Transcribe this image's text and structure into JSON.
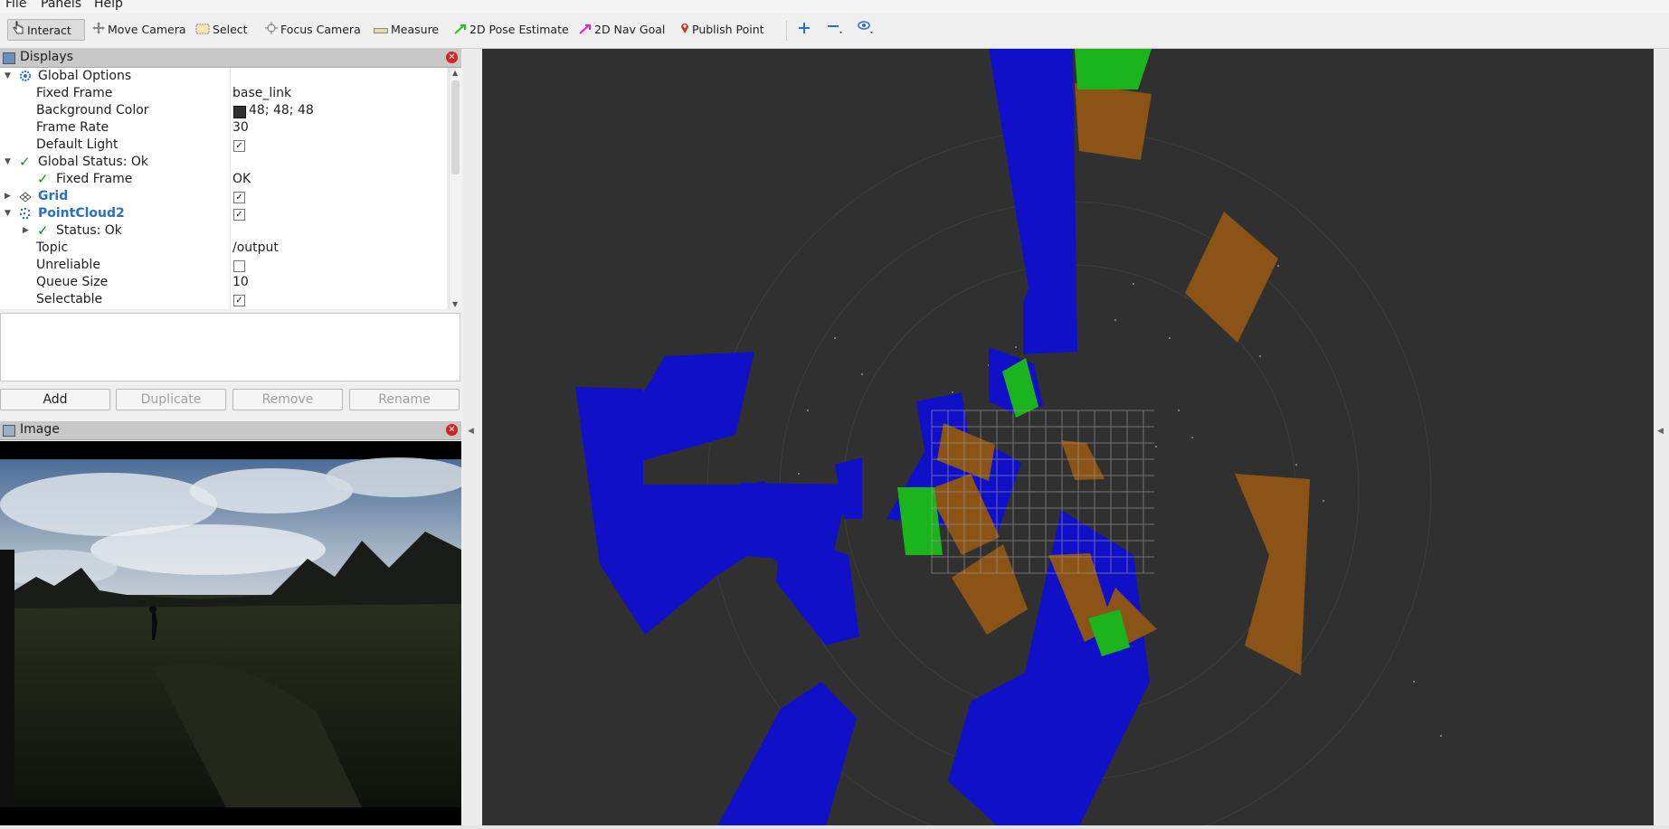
{
  "menu": {
    "file": "File",
    "panels": "Panels",
    "help": "Help"
  },
  "toolbar": {
    "interact": "Interact",
    "move_camera": "Move Camera",
    "select": "Select",
    "focus_camera": "Focus Camera",
    "measure": "Measure",
    "pose_estimate": "2D Pose Estimate",
    "nav_goal": "2D Nav Goal",
    "publish_point": "Publish Point"
  },
  "displays_panel": {
    "title": "Displays",
    "rows": [
      {
        "label": "Global Options",
        "value": ""
      },
      {
        "label": "Fixed Frame",
        "value": "base_link"
      },
      {
        "label": "Background Color",
        "value": "48; 48; 48"
      },
      {
        "label": "Frame Rate",
        "value": "30"
      },
      {
        "label": "Default Light",
        "value": "✓"
      },
      {
        "label": "Global Status: Ok",
        "value": ""
      },
      {
        "label": "Fixed Frame",
        "value": "OK"
      },
      {
        "label": "Grid",
        "value": "✓"
      },
      {
        "label": "PointCloud2",
        "value": "✓"
      },
      {
        "label": "Status: Ok",
        "value": ""
      },
      {
        "label": "Topic",
        "value": "/output"
      },
      {
        "label": "Unreliable",
        "value": ""
      },
      {
        "label": "Queue Size",
        "value": "10"
      },
      {
        "label": "Selectable",
        "value": "✓"
      }
    ],
    "buttons": {
      "add": "Add",
      "duplicate": "Duplicate",
      "remove": "Remove",
      "rename": "Rename"
    }
  },
  "image_panel": {
    "title": "Image"
  },
  "colors": {
    "background": "#303030",
    "blue_sector": "#1010c8",
    "orange_sector": "#8c5316",
    "green_sector": "#1cb41c",
    "accent_link": "#2a6fc9",
    "status_ok": "#1c8c1c"
  },
  "icons": {
    "interact": "hand-pointer-icon",
    "move_camera": "move-arrows-icon",
    "select": "select-rectangle-icon",
    "focus_camera": "focus-target-icon",
    "measure": "ruler-icon",
    "pose_estimate": "green-arrow-icon",
    "nav_goal": "magenta-arrow-icon",
    "publish_point": "map-pin-icon",
    "zoom_in": "plus-crosshair-icon",
    "zoom_out": "minus-icon",
    "view": "eye-icon"
  }
}
